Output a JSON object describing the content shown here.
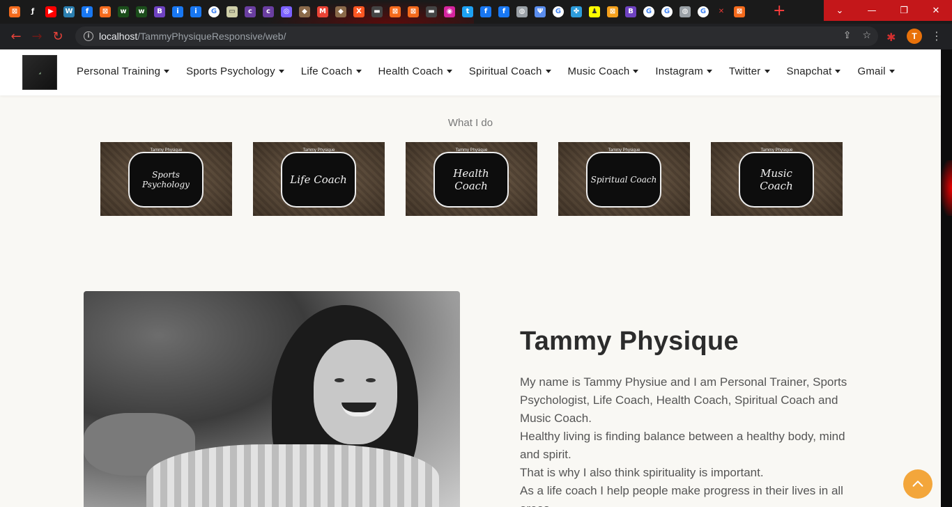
{
  "browser": {
    "tabs": [
      {
        "icon": "xampp-icon",
        "color": "#f46a1c",
        "glyph": "⊠"
      },
      {
        "icon": "generic-icon",
        "color": "#1a1a1a",
        "glyph": "ƒ"
      },
      {
        "icon": "youtube-icon",
        "color": "#ff0000",
        "glyph": "▶"
      },
      {
        "icon": "wordpress-icon",
        "color": "#2b7fb0",
        "glyph": "W"
      },
      {
        "icon": "facebook-icon",
        "color": "#1877f2",
        "glyph": "f"
      },
      {
        "icon": "xampp-icon",
        "color": "#f46a1c",
        "glyph": "⊠"
      },
      {
        "icon": "w-icon",
        "color": "#1b4d1b",
        "glyph": "w"
      },
      {
        "icon": "w-icon",
        "color": "#1b4d1b",
        "glyph": "w"
      },
      {
        "icon": "bootstrap-icon",
        "color": "#6f42c1",
        "glyph": "B"
      },
      {
        "icon": "info-icon",
        "color": "#1877f2",
        "glyph": "i"
      },
      {
        "icon": "info-icon",
        "color": "#1877f2",
        "glyph": "i"
      },
      {
        "icon": "google-icon",
        "color": "#ffffff",
        "glyph": "G"
      },
      {
        "icon": "generic-icon",
        "color": "#cfcfa8",
        "glyph": "▭"
      },
      {
        "icon": "colorlib-icon",
        "color": "#6a3ea1",
        "glyph": "c"
      },
      {
        "icon": "colorlib-icon",
        "color": "#6a3ea1",
        "glyph": "c"
      },
      {
        "icon": "generic-icon",
        "color": "#7b61ff",
        "glyph": "◎"
      },
      {
        "icon": "generic-icon",
        "color": "#8a6a4a",
        "glyph": "◆"
      },
      {
        "icon": "gmail-icon",
        "color": "#ea4335",
        "glyph": "M"
      },
      {
        "icon": "generic-icon",
        "color": "#8a6a4a",
        "glyph": "◆"
      },
      {
        "icon": "xt-icon",
        "color": "#ff5722",
        "glyph": "X"
      },
      {
        "icon": "generic-icon",
        "color": "#444444",
        "glyph": "▬"
      },
      {
        "icon": "xampp-icon",
        "color": "#f46a1c",
        "glyph": "⊠"
      },
      {
        "icon": "xampp-icon",
        "color": "#f46a1c",
        "glyph": "⊠"
      },
      {
        "icon": "generic-icon",
        "color": "#444444",
        "glyph": "▬"
      },
      {
        "icon": "instagram-icon",
        "color": "#d6249f",
        "glyph": "◉"
      },
      {
        "icon": "twitter-icon",
        "color": "#1da1f2",
        "glyph": "t"
      },
      {
        "icon": "facebook-icon",
        "color": "#1877f2",
        "glyph": "f"
      },
      {
        "icon": "facebook-icon",
        "color": "#1877f2",
        "glyph": "f"
      },
      {
        "icon": "globe-icon",
        "color": "#9aa0a6",
        "glyph": "◍"
      },
      {
        "icon": "generic-icon",
        "color": "#5a8dee",
        "glyph": "Ψ"
      },
      {
        "icon": "google-icon",
        "color": "#ffffff",
        "glyph": "G"
      },
      {
        "icon": "generic-icon",
        "color": "#2d9cdb",
        "glyph": "✤"
      },
      {
        "icon": "snapchat-icon",
        "color": "#fffc00",
        "glyph": "♟"
      },
      {
        "icon": "xampp-icon",
        "color": "#f4a01c",
        "glyph": "⊠"
      },
      {
        "icon": "bootstrap-icon",
        "color": "#6f42c1",
        "glyph": "B"
      },
      {
        "icon": "google-icon",
        "color": "#ffffff",
        "glyph": "G"
      },
      {
        "icon": "google-icon",
        "color": "#ffffff",
        "glyph": "G"
      },
      {
        "icon": "globe-icon",
        "color": "#9aa0a6",
        "glyph": "◍"
      },
      {
        "icon": "google-icon",
        "color": "#ffffff",
        "glyph": "G"
      },
      {
        "icon": "close-icon",
        "color": "#e53935",
        "glyph": "✕"
      },
      {
        "icon": "xampp-icon",
        "color": "#f46a1c",
        "glyph": "⊠"
      }
    ],
    "url_host": "localhost",
    "url_path": "/TammyPhysiqueResponsive/web/",
    "profile_initial": "T"
  },
  "nav": {
    "items": [
      {
        "label": "Personal Training",
        "name": "nav-personal-training"
      },
      {
        "label": "Sports Psychology",
        "name": "nav-sports-psychology"
      },
      {
        "label": "Life Coach",
        "name": "nav-life-coach"
      },
      {
        "label": "Health Coach",
        "name": "nav-health-coach"
      },
      {
        "label": "Spiritual Coach",
        "name": "nav-spiritual-coach"
      },
      {
        "label": "Music Coach",
        "name": "nav-music-coach"
      },
      {
        "label": "Instagram",
        "name": "nav-instagram"
      },
      {
        "label": "Twitter",
        "name": "nav-twitter"
      },
      {
        "label": "Snapchat",
        "name": "nav-snapchat"
      },
      {
        "label": "Gmail",
        "name": "nav-gmail"
      }
    ]
  },
  "what_i_do": {
    "title": "What I do",
    "cards": [
      {
        "brand": "Tammy Physique",
        "label": "Sports Psychology"
      },
      {
        "brand": "Tammy Physique",
        "label": "Life Coach"
      },
      {
        "brand": "Tammy Physique",
        "label": "Health Coach"
      },
      {
        "brand": "Tammy Physique",
        "label": "Spiritual Coach"
      },
      {
        "brand": "Tammy Physique",
        "label": "Music Coach"
      }
    ]
  },
  "bio": {
    "title": "Tammy Physique",
    "paragraphs": [
      "My name is Tammy Physiue and I am Personal Trainer, Sports Psychologist, Life Coach, Health Coach, Spiritual Coach and Music Coach.",
      "Healthy living is finding balance between a healthy body, mind and spirit.",
      "That is why I also think spirituality is important.",
      "As a life coach I help people make progress in their lives in all areas."
    ]
  },
  "colors": {
    "accent": "#f3a63b",
    "page_bg": "#f9f8f4",
    "chrome_red": "#c4171a"
  }
}
